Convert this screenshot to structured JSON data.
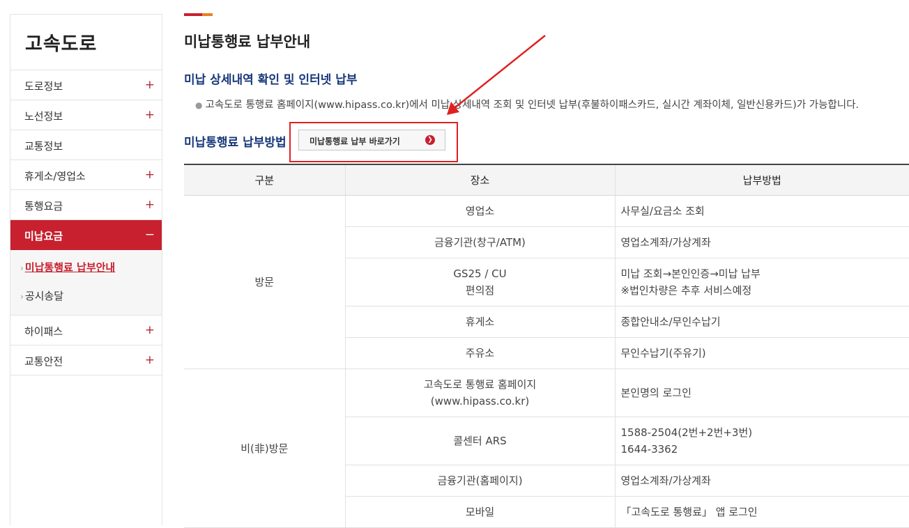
{
  "sidebar": {
    "title": "고속도로",
    "items": [
      {
        "label": "도로정보",
        "toggle": "+"
      },
      {
        "label": "노선정보",
        "toggle": "+"
      },
      {
        "label": "교통정보",
        "toggle": ""
      },
      {
        "label": "휴게소/영업소",
        "toggle": "+"
      },
      {
        "label": "통행요금",
        "toggle": "+"
      },
      {
        "label": "미납요금",
        "toggle": "−"
      },
      {
        "label": "하이패스",
        "toggle": "+"
      },
      {
        "label": "교통안전",
        "toggle": "+"
      }
    ],
    "sub_items": [
      {
        "label": "미납통행료 납부안내"
      },
      {
        "label": "공시송달"
      }
    ]
  },
  "main": {
    "title": "미납통행료 납부안내",
    "section1_title": "미납 상세내역 확인 및 인터넷 납부",
    "section1_desc": "고속도로 통행료 홈페이지(www.hipass.co.kr)에서 미납 상세내역 조회 및 인터넷 납부(후불하이패스카드, 실시간 계좌이체, 일반신용카드)가 가능합니다.",
    "section2_title": "미납통행료 납부방법",
    "go_button": "미납통행료 납부 바로가기"
  },
  "table": {
    "headers": [
      "구분",
      "장소",
      "납부방법"
    ],
    "groups": [
      {
        "label": "방문",
        "rows": [
          {
            "place": [
              "영업소"
            ],
            "method": [
              "사무실/요금소 조회"
            ]
          },
          {
            "place": [
              "금융기관(창구/ATM)"
            ],
            "method": [
              "영업소계좌/가상계좌"
            ]
          },
          {
            "place": [
              "GS25 / CU",
              "편의점"
            ],
            "method": [
              "미납 조회→본인인증→미납 납부",
              "※법인차량은 추후 서비스예정"
            ]
          },
          {
            "place": [
              "휴게소"
            ],
            "method": [
              "종합안내소/무인수납기"
            ]
          },
          {
            "place": [
              "주유소"
            ],
            "method": [
              "무인수납기(주유기)"
            ]
          }
        ]
      },
      {
        "label": "비(非)방문",
        "rows": [
          {
            "place": [
              "고속도로 통행료 홈페이지",
              "(www.hipass.co.kr)"
            ],
            "method": [
              "본인명의 로그인"
            ]
          },
          {
            "place": [
              "콜센터 ARS"
            ],
            "method": [
              "1588-2504(2번+2번+3번)",
              "1644-3362"
            ]
          },
          {
            "place": [
              "금융기관(홈페이지)"
            ],
            "method": [
              "영업소계좌/가상계좌"
            ]
          },
          {
            "place": [
              "모바일"
            ],
            "method": [
              "「고속도로 통행료」 앱 로그인"
            ]
          }
        ]
      }
    ]
  },
  "colors": {
    "brand_red": "#c8202f",
    "accent_orange": "#e5821f",
    "heading_navy": "#17387a",
    "annotation_red": "#e02020"
  }
}
